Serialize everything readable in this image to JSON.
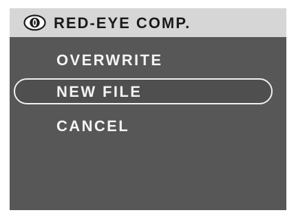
{
  "header": {
    "icon": "red-eye-icon",
    "title": "RED-EYE COMP."
  },
  "menu": {
    "items": [
      {
        "label": "OVERWRITE",
        "selected": false
      },
      {
        "label": "NEW FILE",
        "selected": true
      },
      {
        "label": "CANCEL",
        "selected": false
      }
    ]
  },
  "colors": {
    "background": "#575757",
    "header_background": "#d6d6d6",
    "text": "#f4f4f4",
    "header_text": "#1a1a1a",
    "selection_outline": "#f2f2f2"
  }
}
